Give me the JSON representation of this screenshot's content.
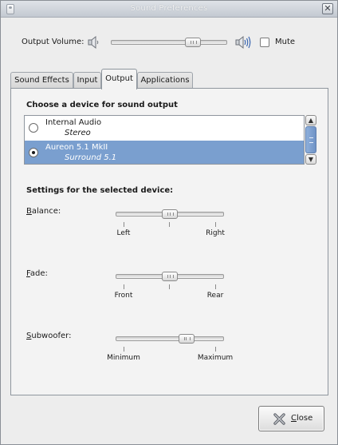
{
  "window": {
    "title": "Sound Preferences"
  },
  "volume": {
    "label": "Output Volume:",
    "level_fraction": 0.74,
    "mute_label": "Mute",
    "muted": false
  },
  "tabs": [
    {
      "label": "Sound Effects",
      "active": false
    },
    {
      "label": "Input",
      "active": false
    },
    {
      "label": "Output",
      "active": true
    },
    {
      "label": "Applications",
      "active": false
    }
  ],
  "output": {
    "choose_title": "Choose a device for sound output",
    "devices": [
      {
        "name": "Internal Audio",
        "profile": "Stereo",
        "selected": false
      },
      {
        "name": "Aureon 5.1 MkII",
        "profile": "Surround 5.1",
        "selected": true
      }
    ],
    "settings_title": "Settings for the selected device:",
    "settings": [
      {
        "label": "Balance:",
        "mnemonic": "B",
        "rest": "alance:",
        "min_label": "Left",
        "max_label": "Right",
        "value_fraction": 0.5
      },
      {
        "label": "Fade:",
        "mnemonic": "F",
        "rest": "ade:",
        "min_label": "Front",
        "max_label": "Rear",
        "value_fraction": 0.5
      },
      {
        "label": "Subwoofer:",
        "mnemonic": "S",
        "rest": "ubwoofer:",
        "min_label": "Minimum",
        "max_label": "Maximum",
        "value_fraction": 0.68
      }
    ]
  },
  "footer": {
    "close_label": "Close",
    "close_mnemonic": "C",
    "close_rest": "lose"
  },
  "colors": {
    "selection": "#7a9fcf",
    "titlebar": "#c3c9d1"
  }
}
